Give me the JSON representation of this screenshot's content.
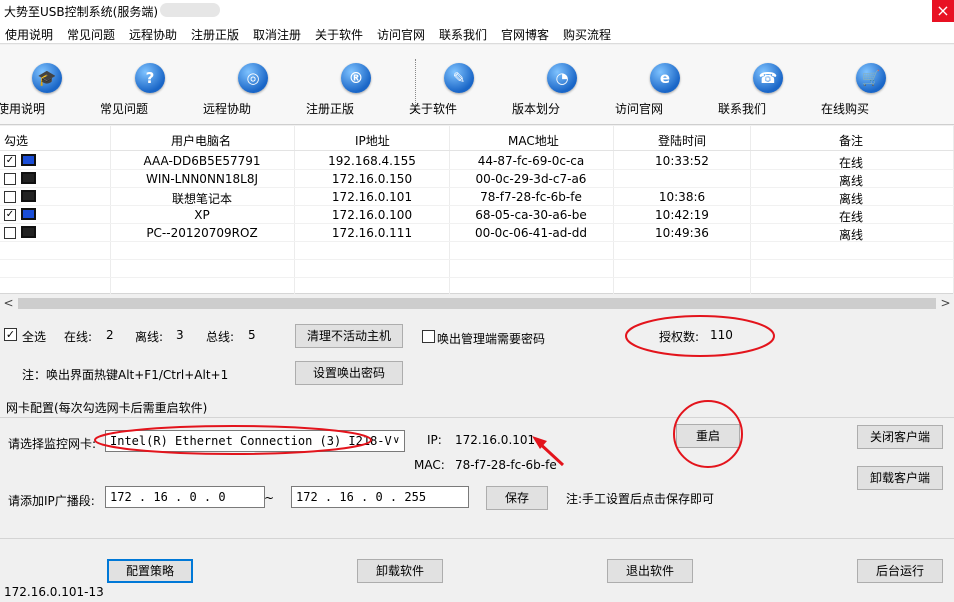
{
  "window": {
    "title": "大势至USB控制系统(服务端)",
    "close_glyph": "×"
  },
  "menu": [
    "使用说明",
    "常见问题",
    "远程协助",
    "注册正版",
    "取消注册",
    "关于软件",
    "访问官网",
    "联系我们",
    "官网博客",
    "购买流程"
  ],
  "toolbar": [
    {
      "label": "使用说明",
      "icon": "graduation-cap-icon",
      "glyph": "🎓"
    },
    {
      "label": "常见问题",
      "icon": "question-icon",
      "glyph": "?"
    },
    {
      "label": "远程协助",
      "icon": "globe-icon",
      "glyph": "◎"
    },
    {
      "label": "注册正版",
      "icon": "registered-icon",
      "glyph": "®"
    },
    {
      "label": "关于软件",
      "icon": "note-icon",
      "glyph": "✎"
    },
    {
      "label": "版本划分",
      "icon": "pie-chart-icon",
      "glyph": "◔"
    },
    {
      "label": "访问官网",
      "icon": "ie-icon",
      "glyph": "e"
    },
    {
      "label": "联系我们",
      "icon": "phone-icon",
      "glyph": "☎"
    },
    {
      "label": "在线购买",
      "icon": "cart-icon",
      "glyph": "🛒"
    }
  ],
  "table": {
    "headers": [
      "勾选",
      "用户电脑名",
      "IP地址",
      "MAC地址",
      "登陆时间",
      "备注"
    ],
    "rows": [
      {
        "checked": true,
        "online": true,
        "name": "AAA-DD6B5E57791",
        "ip": "192.168.4.155",
        "mac": "44-87-fc-69-0c-ca",
        "time": "10:33:52",
        "note": "在线"
      },
      {
        "checked": false,
        "online": false,
        "name": "WIN-LNN0NN18L8J",
        "ip": "172.16.0.150",
        "mac": "00-0c-29-3d-c7-a6",
        "time": "",
        "note": "离线"
      },
      {
        "checked": false,
        "online": false,
        "name": "联想笔记本",
        "ip": "172.16.0.101",
        "mac": "78-f7-28-fc-6b-fe",
        "time": "10:38:6",
        "note": "离线"
      },
      {
        "checked": true,
        "online": true,
        "name": "XP",
        "ip": "172.16.0.100",
        "mac": "68-05-ca-30-a6-be",
        "time": "10:42:19",
        "note": "在线"
      },
      {
        "checked": false,
        "online": false,
        "name": "PC--20120709ROZ",
        "ip": "172.16.0.111",
        "mac": "00-0c-06-41-ad-dd",
        "time": "10:49:36",
        "note": "离线"
      }
    ]
  },
  "scroll": {
    "left": "<",
    "right": ">"
  },
  "summary": {
    "select_all": "全选",
    "select_all_checked": true,
    "online_label": "在线:",
    "online_count": "2",
    "offline_label": "离线:",
    "offline_count": "3",
    "total_label": "总线:",
    "total_count": "5",
    "clean_button": "清理不活动主机",
    "password_check": "唤出管理端需要密码",
    "license_label": "授权数:",
    "license_count": "110",
    "hotkey_note": "注：唤出界面热键Alt+F1/Ctrl+Alt+1",
    "set_password_button": "设置唤出密码"
  },
  "nic": {
    "section_title": "网卡配置(每次勾选网卡后需重启软件)",
    "select_label": "请选择监控网卡:",
    "selected_adapter": "Intel(R) Ethernet Connection (3) I218-V",
    "ip_label": "IP:",
    "ip_value": "172.16.0.101",
    "mac_label": "MAC:",
    "mac_value": "78-f7-28-fc-6b-fe",
    "restart_button": "重启",
    "close_client_button": "关闭客户端",
    "uninstall_client_button": "卸载客户端",
    "broadcast_label": "请添加IP广播段:",
    "range_start": "172 .  16 .  0  .  0",
    "range_sep": "~",
    "range_end": "172 .  16 .  0  . 255",
    "save_button": "保存",
    "save_note": "注:手工设置后点击保存即可"
  },
  "footer": {
    "config_button": "配置策略",
    "uninstall_button": "卸载软件",
    "exit_button": "退出软件",
    "background_button": "后台运行",
    "status_text": "172.16.0.101-13"
  },
  "colors": {
    "annotation_red": "#e3141c",
    "accent": "#0078d7"
  }
}
